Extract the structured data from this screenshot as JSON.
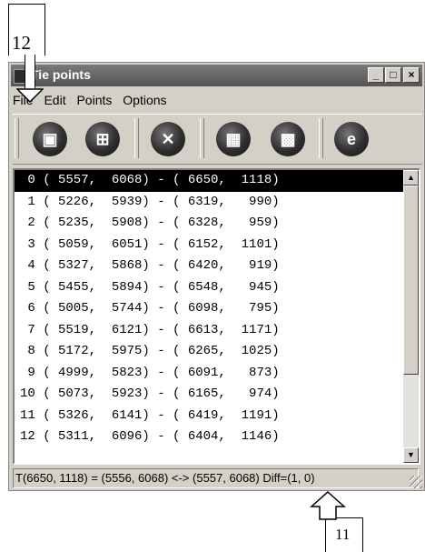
{
  "annotations": {
    "top_label": "12",
    "bottom_label": "11"
  },
  "window": {
    "title": "Tie points",
    "controls": {
      "minimize": "_",
      "maximize": "□",
      "close": "×"
    }
  },
  "menu": [
    "File",
    "Edit",
    "Points",
    "Options"
  ],
  "toolbar": {
    "buttons": [
      {
        "icon": "disk-icon",
        "glyph": "▣"
      },
      {
        "icon": "folder-open-icon",
        "glyph": "⊞"
      },
      {
        "icon": "delete-icon",
        "glyph": "✕"
      },
      {
        "icon": "grid-icon",
        "glyph": "▦"
      },
      {
        "icon": "grid-move-icon",
        "glyph": "▩"
      },
      {
        "icon": "e-icon",
        "glyph": "e"
      }
    ]
  },
  "list": {
    "selected_index": 0,
    "rows": [
      " 0 ( 5557,  6068) - ( 6650,  1118)",
      " 1 ( 5226,  5939) - ( 6319,   990)",
      " 2 ( 5235,  5908) - ( 6328,   959)",
      " 3 ( 5059,  6051) - ( 6152,  1101)",
      " 4 ( 5327,  5868) - ( 6420,   919)",
      " 5 ( 5455,  5894) - ( 6548,   945)",
      " 6 ( 5005,  5744) - ( 6098,   795)",
      " 7 ( 5519,  6121) - ( 6613,  1171)",
      " 8 ( 5172,  5975) - ( 6265,  1025)",
      " 9 ( 4999,  5823) - ( 6091,   873)",
      "10 ( 5073,  5923) - ( 6165,   974)",
      "11 ( 5326,  6141) - ( 6419,  1191)",
      "12 ( 5311,  6096) - ( 6404,  1146)"
    ]
  },
  "status": "T(6650, 1118) = (5556, 6068) <-> (5557, 6068) Diff=(1, 0)"
}
